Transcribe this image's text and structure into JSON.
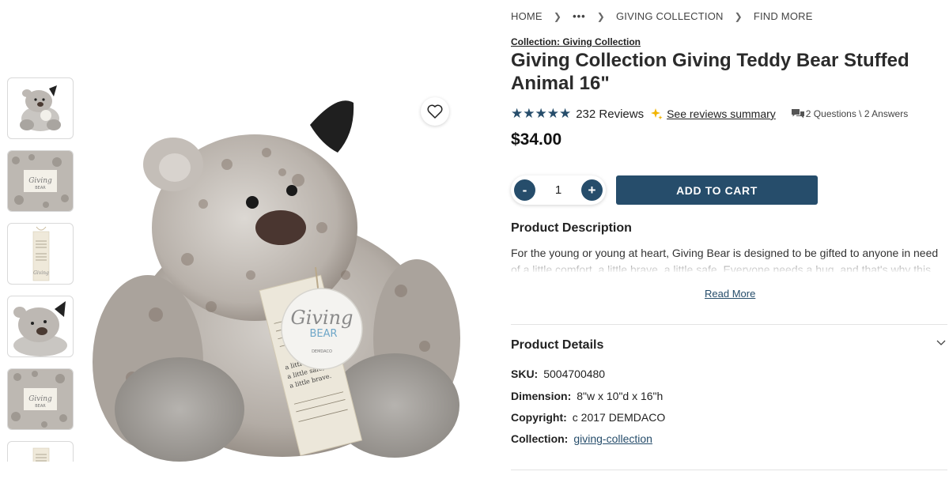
{
  "breadcrumb": {
    "home": "HOME",
    "ellipsis": "•••",
    "collection": "GIVING COLLECTION",
    "current": "FIND MORE"
  },
  "product": {
    "collection_link": "Collection: Giving Collection",
    "title": "Giving Collection Giving Teddy Bear Stuffed Animal 16\"",
    "rating_stars": "★★★★★",
    "rating_value": 5,
    "reviews": "232 Reviews",
    "summary_link": "See reviews summary",
    "qa": "2 Questions \\ 2 Answers",
    "price": "$34.00"
  },
  "cart": {
    "minus": "-",
    "quantity": "1",
    "plus": "+",
    "add_label": "ADD TO CART"
  },
  "description": {
    "heading": "Product Description",
    "text": "For the young or young at heart, Giving Bear is designed to be gifted to anyone in need of a little comfort, a little brave, a little safe. Everyone needs a hug, and that's why this",
    "read_more": "Read More"
  },
  "details": {
    "heading": "Product Details",
    "sku_label": "SKU:",
    "sku": "5004700480",
    "dimension_label": "Dimension:",
    "dimension": "8\"w x 10\"d x 16\"h",
    "copyright_label": "Copyright:",
    "copyright": "c 2017 DEMDACO",
    "collection_label": "Collection:",
    "collection": "giving-collection"
  },
  "image": {
    "tag_text_1": "Giving",
    "tag_text_2": "BEAR",
    "tag_brand": "DEMDACO",
    "card_lines": [
      "a little comfort,",
      "a little safe,",
      "a little brave."
    ]
  },
  "colors": {
    "accent": "#264d6b",
    "star": "#264d6b",
    "spark": "#f2b400"
  },
  "icons": {
    "wishlist": "heart-icon",
    "chevron": "chevron-down-icon",
    "qa": "chat-bubbles-icon",
    "sparkle": "sparkle-icon"
  }
}
